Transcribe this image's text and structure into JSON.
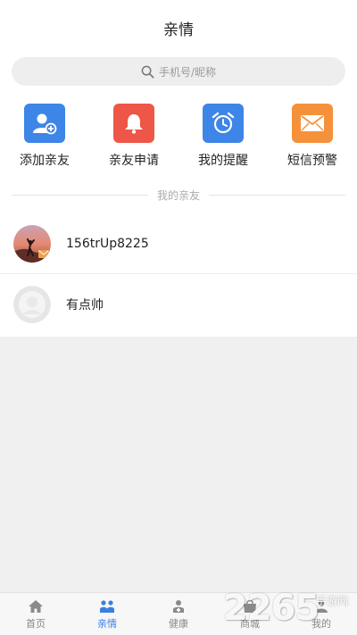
{
  "header": {
    "title": "亲情"
  },
  "search": {
    "placeholder": "手机号/昵称"
  },
  "actions": [
    {
      "label": "添加亲友",
      "icon": "add-user-icon",
      "color": "#3d85e6"
    },
    {
      "label": "亲友申请",
      "icon": "bell-icon",
      "color": "#ee5647"
    },
    {
      "label": "我的提醒",
      "icon": "alarm-clock-icon",
      "color": "#3d85e6"
    },
    {
      "label": "短信预警",
      "icon": "envelope-icon",
      "color": "#f5913a"
    }
  ],
  "section": {
    "title": "我的亲友"
  },
  "friends": [
    {
      "name": "156trUp8225",
      "avatar": "photo-avatar"
    },
    {
      "name": "有点帅",
      "avatar": "default-avatar"
    }
  ],
  "tabbar": {
    "active_color": "#3a7fe0",
    "items": [
      {
        "label": "首页",
        "icon": "home-icon",
        "active": false
      },
      {
        "label": "亲情",
        "icon": "family-icon",
        "active": true
      },
      {
        "label": "健康",
        "icon": "health-icon",
        "active": false
      },
      {
        "label": "商城",
        "icon": "shop-icon",
        "active": false
      },
      {
        "label": "我的",
        "icon": "profile-icon",
        "active": false
      }
    ]
  },
  "watermark": {
    "big": "2265",
    "small": "手游网",
    "suffix": "com"
  }
}
